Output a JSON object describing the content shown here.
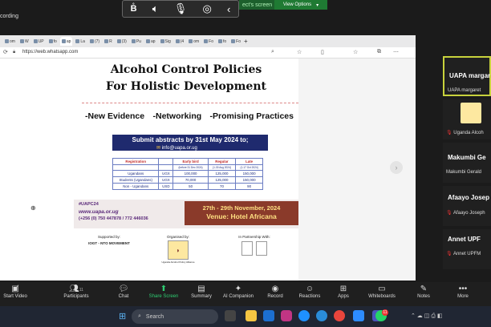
{
  "meeting": {
    "recording_label": "cording",
    "share_status": "ect's screen",
    "view_options_label": "View Options"
  },
  "browser": {
    "url": "https://web.whatsapp.com",
    "tabs": [
      "om",
      "W",
      "UP",
      "fo",
      "ap",
      "La",
      "(7)",
      "R",
      "(3)",
      "Pu",
      "ap",
      "Sig",
      "(4",
      "om",
      "Fo",
      "fo",
      "Fo"
    ]
  },
  "poster": {
    "title_line1": "Alcohol Control Policies",
    "title_line2": "For Holistic Development",
    "themes": [
      "-New Evidence",
      "-Networking",
      "-Promising Practices"
    ],
    "submit_text": "Submit abstracts by 31st May 2024 to;",
    "email": "info@uapa.or.ug",
    "fees_table": {
      "headers": [
        "Registration",
        "Early bird",
        "Regular",
        "Late"
      ],
      "subheaders": [
        "",
        "(before 31 Dec 2024)",
        "(1-30 Aug 2024)",
        "(1-17 Oct 2024)"
      ],
      "rows": [
        [
          "Ugandans",
          "UGX",
          "100,000",
          "125,000",
          "150,000"
        ],
        [
          "Students (Ugandans)",
          "UGX",
          "70,000",
          "125,000",
          "150,000"
        ],
        [
          "Non - Ugandans",
          "USD",
          "50",
          "70",
          "90"
        ]
      ]
    },
    "hashtag": "#UAPC24",
    "website": "www.uapa.or.ug",
    "phones": "(+256 (0) 750 447878 / 772 446036",
    "dates": "27th - 29th November, 2024",
    "venue": "Venue: Hotel Africana",
    "supported_by_label": "Supported by:",
    "supported_by": "IOGT - NTO MOVEMENT",
    "organised_by_label": "Organised by:",
    "organiser": "Uganda Alcohol Policy Alliance",
    "partnership_label": "In Partnership With:"
  },
  "participants": [
    {
      "name": "UAPA margar",
      "label": "UAPA margaret",
      "highlight": true
    },
    {
      "name": "",
      "label": "Uganda Alcoh"
    },
    {
      "name": "Makumbi Ge",
      "label": "Makumbi Gerald"
    },
    {
      "name": "Afaayo Josep",
      "label": "Afaayo Joseph"
    },
    {
      "name": "Annet UPF",
      "label": "Annet UPFM"
    }
  ],
  "toolbar": [
    {
      "label": "Start Video",
      "icon": "video-off-icon"
    },
    {
      "label": "Participants",
      "icon": "participants-icon",
      "count": "11"
    },
    {
      "label": "Chat",
      "icon": "chat-icon"
    },
    {
      "label": "Share Screen",
      "icon": "share-screen-icon"
    },
    {
      "label": "Summary",
      "icon": "summary-icon"
    },
    {
      "label": "AI Companion",
      "icon": "ai-companion-icon"
    },
    {
      "label": "Record",
      "icon": "record-icon"
    },
    {
      "label": "Reactions",
      "icon": "reactions-icon"
    },
    {
      "label": "Apps",
      "icon": "apps-icon"
    },
    {
      "label": "Whiteboards",
      "icon": "whiteboards-icon"
    },
    {
      "label": "Notes",
      "icon": "notes-icon"
    },
    {
      "label": "More",
      "icon": "more-icon"
    }
  ],
  "taskbar": {
    "search_placeholder": "Search",
    "whatsapp_badge": "11"
  },
  "colors": {
    "share_green": "#1f7a33",
    "poster_navy": "#1f2a6e",
    "venue_brown": "#8a3a2a",
    "tile_highlight": "#c8d23c"
  }
}
